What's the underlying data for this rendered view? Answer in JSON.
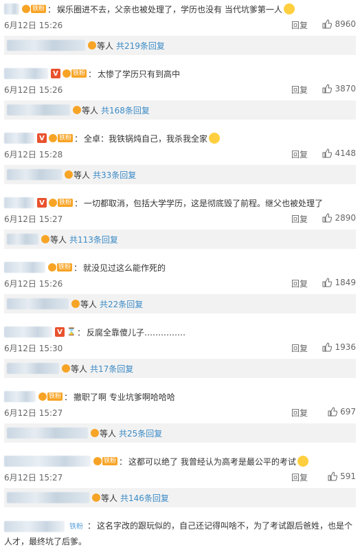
{
  "ui": {
    "reply_label": "回复",
    "others_label": "等人",
    "fan_label": "铁粉"
  },
  "comments": [
    {
      "text": "娱乐圈进不去，父亲也被处理了，学历也没有 当代坑爹第一人",
      "date": "6月12日 15:26",
      "likes": "8960",
      "reply_count": "共219条回复",
      "vip": false,
      "emoji": true
    },
    {
      "text": "太惨了学历只有到高中",
      "date": "6月12日 15:26",
      "likes": "3870",
      "reply_count": "共168条回复",
      "vip": true,
      "emoji": false
    },
    {
      "text": "全卓：我铁锅炖自己，我杀我全家",
      "date": "6月12日 15:28",
      "likes": "4148",
      "reply_count": "共33条回复",
      "vip": true,
      "emoji": true
    },
    {
      "text": "一切都取消，包括大学学历，这是彻底毁了前程。继父也被处理了",
      "date": "6月12日 15:27",
      "likes": "2890",
      "reply_count": "共113条回复",
      "vip": true,
      "emoji": false
    },
    {
      "text": "就没见过这么能作死的",
      "date": "6月12日 15:26",
      "likes": "1849",
      "reply_count": "共22条回复",
      "vip": false,
      "emoji": false
    },
    {
      "text": "反腐全靠傻儿子……………",
      "date": "6月12日 15:30",
      "likes": "1936",
      "reply_count": "共17条回复",
      "vip": true,
      "emoji": false
    },
    {
      "text": "撤职了啊 专业坑爹啊哈哈哈",
      "date": "6月12日 15:27",
      "likes": "697",
      "reply_count": "共25条回复",
      "vip": false,
      "emoji": false
    },
    {
      "text": "这都可以绝了 我曾经认为高考是最公平的考试",
      "date": "6月12日 15:27",
      "likes": "591",
      "reply_count": "共146条回复",
      "vip": false,
      "emoji": true
    }
  ],
  "last_comment": {
    "text": "这名字改的跟玩似的，自己还记得叫啥不，为了考试跟后爸姓，也是个人才，最终坑了后爹。"
  },
  "colors": {
    "accent": "#3b8ac6",
    "fan_orange": "#f7a426",
    "vip_red": "#e8522e"
  }
}
